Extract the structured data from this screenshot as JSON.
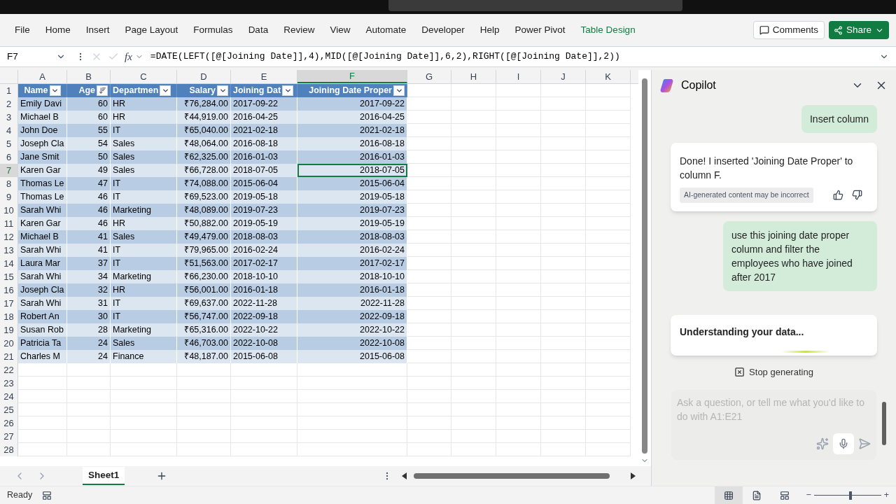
{
  "menu": [
    {
      "label": "File",
      "kind": "normal"
    },
    {
      "label": "Home",
      "kind": "normal"
    },
    {
      "label": "Insert",
      "kind": "normal"
    },
    {
      "label": "Page Layout",
      "kind": "normal"
    },
    {
      "label": "Formulas",
      "kind": "normal"
    },
    {
      "label": "Data",
      "kind": "normal"
    },
    {
      "label": "Review",
      "kind": "normal"
    },
    {
      "label": "View",
      "kind": "normal"
    },
    {
      "label": "Automate",
      "kind": "normal"
    },
    {
      "label": "Developer",
      "kind": "normal"
    },
    {
      "label": "Help",
      "kind": "normal"
    },
    {
      "label": "Power Pivot",
      "kind": "normal"
    },
    {
      "label": "Table Design",
      "kind": "contextual"
    }
  ],
  "comments_button": "Comments",
  "share_button": "Share",
  "formula_bar": {
    "name_box": "F7",
    "function_button": "fx",
    "formula": "=DATE(LEFT([@[Joining Date]],4),MID([@[Joining Date]],6,2),RIGHT([@[Joining Date]],2))"
  },
  "columns": [
    {
      "letter": "A",
      "selected": false
    },
    {
      "letter": "B",
      "selected": false
    },
    {
      "letter": "C",
      "selected": false
    },
    {
      "letter": "D",
      "selected": false
    },
    {
      "letter": "E",
      "selected": false
    },
    {
      "letter": "F",
      "selected": true
    },
    {
      "letter": "G",
      "selected": false
    },
    {
      "letter": "H",
      "selected": false
    },
    {
      "letter": "I",
      "selected": false
    },
    {
      "letter": "J",
      "selected": false
    },
    {
      "letter": "K",
      "selected": false
    }
  ],
  "table": {
    "headers": [
      {
        "label": "Name",
        "kind": "filter"
      },
      {
        "label": "Age",
        "kind": "sorted"
      },
      {
        "label": "Departmen",
        "kind": "filter"
      },
      {
        "label": "Salary",
        "kind": "filter"
      },
      {
        "label": "Joining Dat",
        "kind": "filter"
      },
      {
        "label": "Joining Date Proper",
        "kind": "filter"
      }
    ],
    "rows": [
      {
        "number": "2",
        "selected": false,
        "cells": [
          "Emily Davi",
          "60",
          "HR",
          "₹76,284.00",
          "2017-09-22",
          "2017-09-22"
        ]
      },
      {
        "number": "3",
        "selected": false,
        "cells": [
          "Michael B",
          "60",
          "HR",
          "₹44,919.00",
          "2016-04-25",
          "2016-04-25"
        ]
      },
      {
        "number": "4",
        "selected": false,
        "cells": [
          "John Doe",
          "55",
          "IT",
          "₹65,040.00",
          "2021-02-18",
          "2021-02-18"
        ]
      },
      {
        "number": "5",
        "selected": false,
        "cells": [
          "Joseph Cla",
          "54",
          "Sales",
          "₹48,064.00",
          "2016-08-18",
          "2016-08-18"
        ]
      },
      {
        "number": "6",
        "selected": false,
        "cells": [
          "Jane Smit",
          "50",
          "Sales",
          "₹62,325.00",
          "2016-01-03",
          "2016-01-03"
        ]
      },
      {
        "number": "7",
        "selected": true,
        "cells": [
          "Karen Gar",
          "49",
          "Sales",
          "₹66,728.00",
          "2018-07-05",
          "2018-07-05"
        ]
      },
      {
        "number": "8",
        "selected": false,
        "cells": [
          "Thomas Le",
          "47",
          "IT",
          "₹74,088.00",
          "2015-06-04",
          "2015-06-04"
        ]
      },
      {
        "number": "9",
        "selected": false,
        "cells": [
          "Thomas Le",
          "46",
          "IT",
          "₹69,523.00",
          "2019-05-18",
          "2019-05-18"
        ]
      },
      {
        "number": "10",
        "selected": false,
        "cells": [
          "Sarah Whi",
          "46",
          "Marketing",
          "₹48,089.00",
          "2019-07-23",
          "2019-07-23"
        ]
      },
      {
        "number": "11",
        "selected": false,
        "cells": [
          "Karen Gar",
          "46",
          "HR",
          "₹50,882.00",
          "2019-05-19",
          "2019-05-19"
        ]
      },
      {
        "number": "12",
        "selected": false,
        "cells": [
          "Michael B",
          "41",
          "Sales",
          "₹49,479.00",
          "2018-08-03",
          "2018-08-03"
        ]
      },
      {
        "number": "13",
        "selected": false,
        "cells": [
          "Sarah Whi",
          "41",
          "IT",
          "₹79,965.00",
          "2016-02-24",
          "2016-02-24"
        ]
      },
      {
        "number": "14",
        "selected": false,
        "cells": [
          "Laura Mar",
          "37",
          "IT",
          "₹51,563.00",
          "2017-02-17",
          "2017-02-17"
        ]
      },
      {
        "number": "15",
        "selected": false,
        "cells": [
          "Sarah Whi",
          "34",
          "Marketing",
          "₹66,230.00",
          "2018-10-10",
          "2018-10-10"
        ]
      },
      {
        "number": "16",
        "selected": false,
        "cells": [
          "Joseph Cla",
          "32",
          "HR",
          "₹56,001.00",
          "2016-01-18",
          "2016-01-18"
        ]
      },
      {
        "number": "17",
        "selected": false,
        "cells": [
          "Sarah Whi",
          "31",
          "IT",
          "₹69,637.00",
          "2022-11-28",
          "2022-11-28"
        ]
      },
      {
        "number": "18",
        "selected": false,
        "cells": [
          "Robert An",
          "30",
          "IT",
          "₹56,747.00",
          "2022-09-18",
          "2022-09-18"
        ]
      },
      {
        "number": "19",
        "selected": false,
        "cells": [
          "Susan Rob",
          "28",
          "Marketing",
          "₹65,316.00",
          "2022-10-22",
          "2022-10-22"
        ]
      },
      {
        "number": "20",
        "selected": false,
        "cells": [
          "Patricia Ta",
          "24",
          "Sales",
          "₹46,703.00",
          "2022-10-08",
          "2022-10-08"
        ]
      },
      {
        "number": "21",
        "selected": false,
        "cells": [
          "Charles M",
          "24",
          "Finance",
          "₹48,187.00",
          "2015-06-08",
          "2015-06-08"
        ]
      }
    ]
  },
  "header_row_number": "1",
  "empty_rows": [
    "22",
    "23",
    "24",
    "25",
    "26",
    "27",
    "28"
  ],
  "sheet_tabs": [
    {
      "label": "Sheet1",
      "selected": true
    }
  ],
  "status": "Ready",
  "views": [
    {
      "kind": "normal",
      "selected": true
    },
    {
      "kind": "page_layout",
      "selected": false
    },
    {
      "kind": "page_break",
      "selected": false
    }
  ],
  "zoom": {
    "minus": "−",
    "plus": "+",
    "level": 0.55
  },
  "copilot": {
    "title": "Copilot",
    "messages": [
      {
        "kind": "user",
        "text": "Insert column"
      },
      {
        "kind": "assistant",
        "text": "Done! I inserted 'Joining Date Proper' to column F.",
        "note": "AI-generated content may be incorrect"
      },
      {
        "kind": "user",
        "text": "use this joining date proper column and filter the employees who have joined after 2017"
      },
      {
        "kind": "progress",
        "text": "Understanding your data..."
      }
    ],
    "stop_button": "Stop generating",
    "input_placeholder": "Ask a question, or tell me what you'd like to do with A1:E21"
  }
}
